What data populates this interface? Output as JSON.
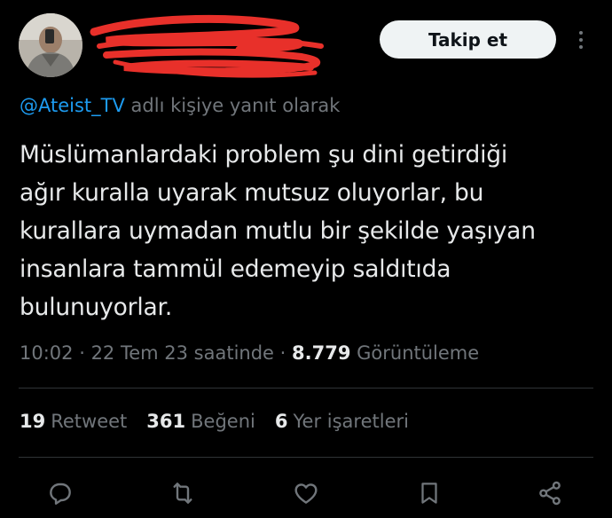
{
  "header": {
    "follow_label": "Takip et",
    "avatar_icon": "user-photo-avatar",
    "more_icon": "more-vertical-icon"
  },
  "reply": {
    "mention": "@Ateist_TV",
    "suffix": " adlı kişiye yanıt olarak"
  },
  "tweet": {
    "lines": [
      "Müslümanlardaki problem şu dini getirdiği",
      "ağır kuralla uyarak mutsuz oluyorlar, bu",
      "kurallara uymadan mutlu bir şekilde yaşıyan",
      "insanlara tammül edemeyip saldıtıda",
      "bulunuyorlar."
    ]
  },
  "meta": {
    "time": "10:02",
    "sep1": " · ",
    "date": "22 Tem 23 saatinde",
    "sep2": " · ",
    "views_count": "8.779",
    "views_label": " Görüntüleme"
  },
  "stats": {
    "retweets_count": "19",
    "retweets_label": "Retweet",
    "likes_count": "361",
    "likes_label": "Beğeni",
    "bookmarks_count": "6",
    "bookmarks_label": "Yer işaretleri"
  },
  "actions": {
    "icons": [
      "reply-icon",
      "retweet-icon",
      "like-icon",
      "bookmark-icon",
      "share-icon"
    ]
  },
  "colors": {
    "background": "#000000",
    "text": "#e7e9ea",
    "muted": "#71767b",
    "link": "#1d9bf0",
    "redaction": "#e8302a"
  }
}
